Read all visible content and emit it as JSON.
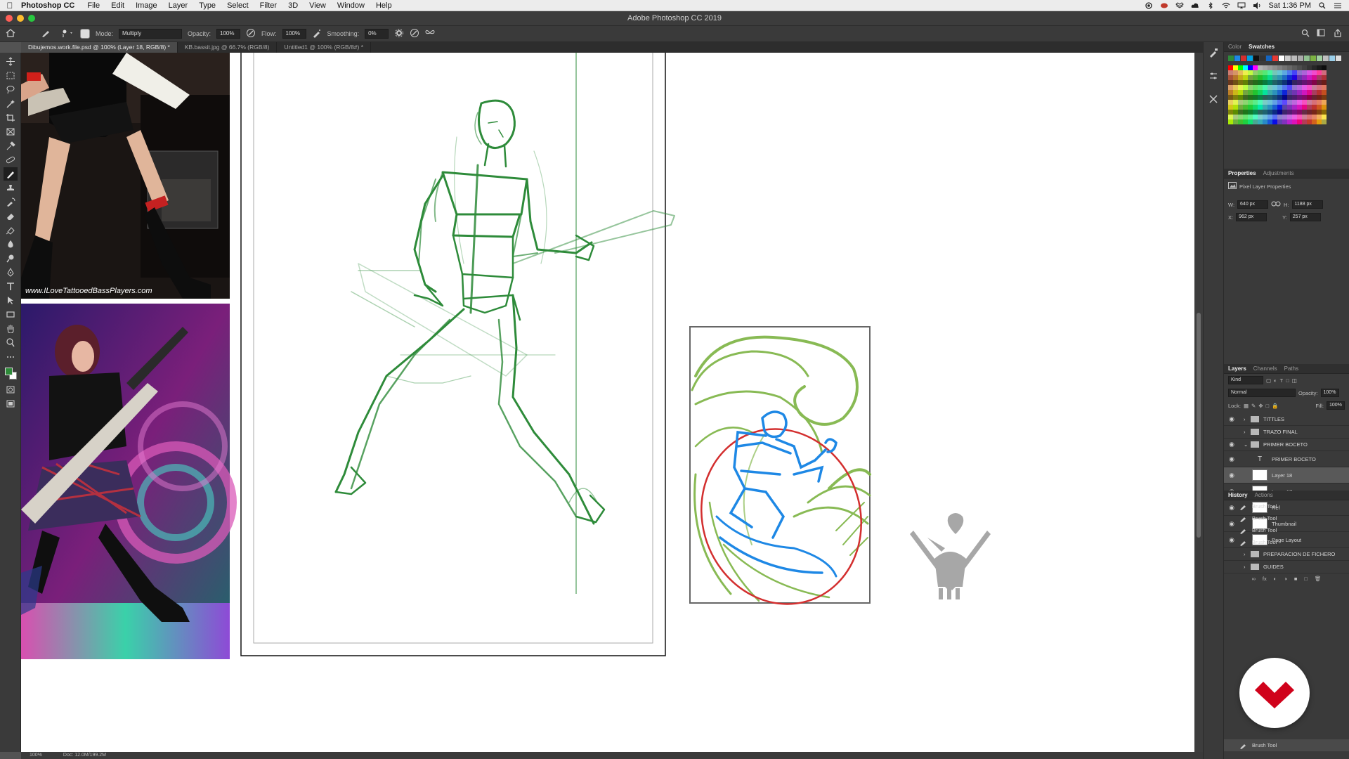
{
  "menubar": {
    "app_name": "Photoshop CC",
    "menus": [
      "File",
      "Edit",
      "Image",
      "Layer",
      "Type",
      "Select",
      "Filter",
      "3D",
      "View",
      "Window",
      "Help"
    ],
    "clock": "Sat 1:36 PM"
  },
  "window": {
    "title": "Adobe Photoshop CC 2019"
  },
  "options": {
    "mode_label": "Mode:",
    "mode_value": "Multiply",
    "opacity_label": "Opacity:",
    "opacity_value": "100%",
    "flow_label": "Flow:",
    "flow_value": "100%",
    "smoothing_label": "Smoothing:",
    "smoothing_value": "0%"
  },
  "tabs": [
    {
      "label": "Dibujemos.work.file.psd @ 100% (Layer 18, RGB/8) *"
    },
    {
      "label": "KB.bassit.jpg @ 66.7% (RGB/8)"
    },
    {
      "label": "Untitled1 @ 100% (RGB/8#) *"
    }
  ],
  "canvas": {
    "ref_watermark": "www.ILoveTattooedBassPlayers.com"
  },
  "status": {
    "zoom": "100%",
    "doc": "Doc: 12.0M/199.2M"
  },
  "panels": {
    "color_tabs": [
      "Color",
      "Swatches"
    ],
    "properties_tabs": [
      "Properties",
      "Adjustments"
    ],
    "properties_title": "Pixel Layer Properties",
    "w_label": "W:",
    "w_value": "640 px",
    "h_label": "H:",
    "h_value": "1188 px",
    "x_label": "X:",
    "x_value": "962 px",
    "y_label": "Y:",
    "y_value": "257 px",
    "layers_tabs": [
      "Layers",
      "Channels",
      "Paths"
    ],
    "kind_label": "Kind",
    "blend_mode": "Normal",
    "layers_opacity_label": "Opacity:",
    "layers_opacity_value": "100%",
    "lock_label": "Lock:",
    "fill_label": "Fill:",
    "fill_value": "100%",
    "layers": [
      {
        "name": "TITTLES",
        "type": "folder"
      },
      {
        "name": "TRAZO FINAL",
        "type": "folder"
      },
      {
        "name": "PRIMER BOCETO",
        "type": "folder"
      },
      {
        "name": "PRIMER BOCETO",
        "type": "text"
      },
      {
        "name": "Layer 18",
        "type": "pixel"
      },
      {
        "name": "Layer 17",
        "type": "pixel"
      },
      {
        "name": "Ref",
        "type": "pixel"
      },
      {
        "name": "Thumbnail",
        "type": "pixel"
      },
      {
        "name": "Page Layout",
        "type": "pixel"
      },
      {
        "name": "PREPARACION DE FICHERO",
        "type": "folder"
      },
      {
        "name": "GUIDES",
        "type": "folder"
      }
    ],
    "history_tabs": [
      "History",
      "Actions"
    ],
    "history_items": [
      "Brush Tool",
      "Brush Tool",
      "Brush Tool",
      "Brush Tool"
    ],
    "history_last": "Brush Tool"
  },
  "colors": {
    "sketch_green": "#2e8b3a",
    "thumb_green": "#7cb342",
    "thumb_blue": "#1e88e5",
    "thumb_red": "#d32f2f",
    "accent_red": "#d0021b"
  }
}
